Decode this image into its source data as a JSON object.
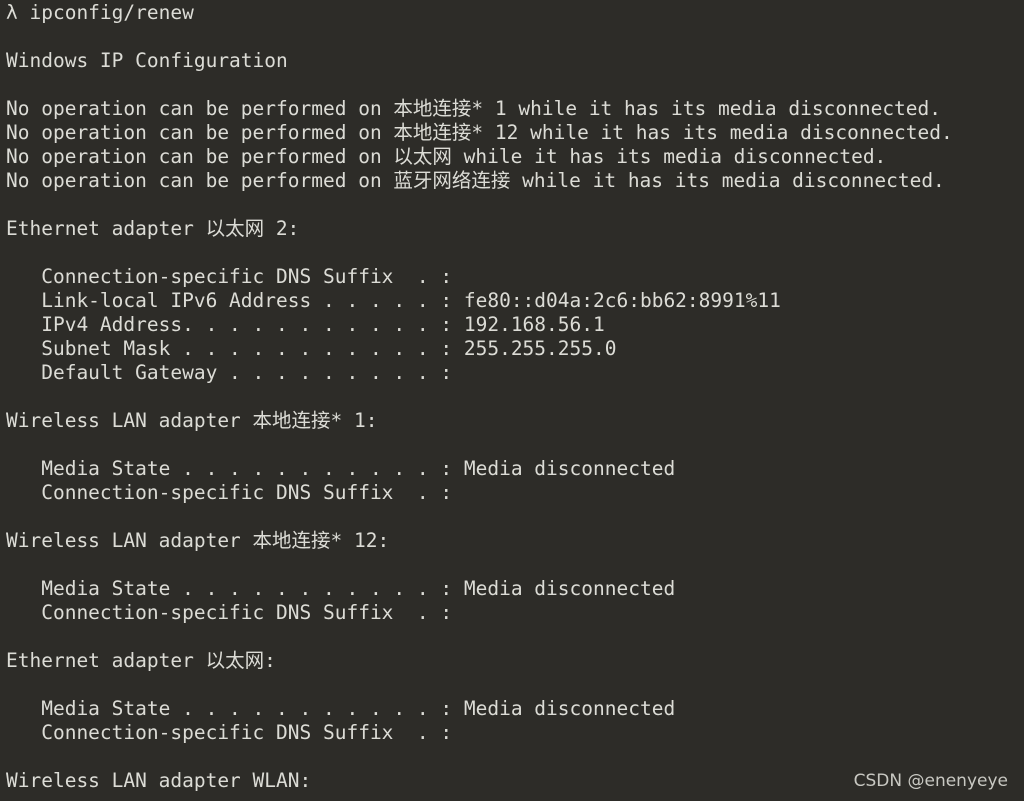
{
  "terminal": {
    "lines": [
      "λ ipconfig/renew",
      "",
      "Windows IP Configuration",
      "",
      "No operation can be performed on 本地连接* 1 while it has its media disconnected.",
      "No operation can be performed on 本地连接* 12 while it has its media disconnected.",
      "No operation can be performed on 以太网 while it has its media disconnected.",
      "No operation can be performed on 蓝牙网络连接 while it has its media disconnected.",
      "",
      "Ethernet adapter 以太网 2:",
      "",
      "   Connection-specific DNS Suffix  . :",
      "   Link-local IPv6 Address . . . . . : fe80::d04a:2c6:bb62:8991%11",
      "   IPv4 Address. . . . . . . . . . . : 192.168.56.1",
      "   Subnet Mask . . . . . . . . . . . : 255.255.255.0",
      "   Default Gateway . . . . . . . . . :",
      "",
      "Wireless LAN adapter 本地连接* 1:",
      "",
      "   Media State . . . . . . . . . . . : Media disconnected",
      "   Connection-specific DNS Suffix  . :",
      "",
      "Wireless LAN adapter 本地连接* 12:",
      "",
      "   Media State . . . . . . . . . . . : Media disconnected",
      "   Connection-specific DNS Suffix  . :",
      "",
      "Ethernet adapter 以太网:",
      "",
      "   Media State . . . . . . . . . . . : Media disconnected",
      "   Connection-specific DNS Suffix  . :",
      "",
      "Wireless LAN adapter WLAN:"
    ]
  },
  "watermark": "CSDN @enenyeye",
  "colors": {
    "background": "#2d2c28",
    "text": "#dcdcd6"
  }
}
